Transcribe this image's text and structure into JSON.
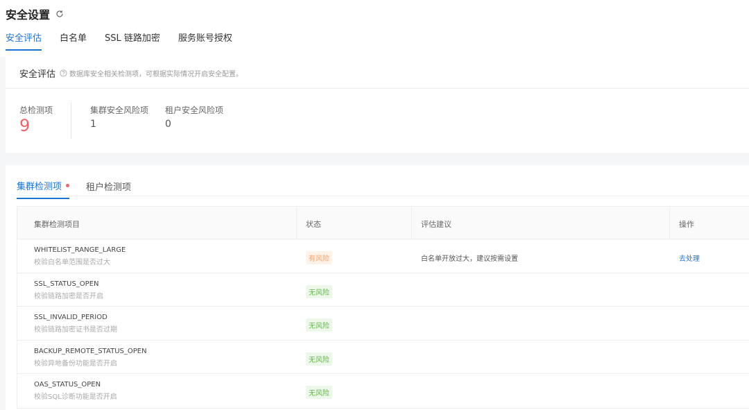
{
  "header": {
    "title": "安全设置",
    "tabs": [
      {
        "label": "安全评估",
        "active": true
      },
      {
        "label": "白名单",
        "active": false
      },
      {
        "label": "SSL 链路加密",
        "active": false
      },
      {
        "label": "服务账号授权",
        "active": false
      }
    ]
  },
  "assessment": {
    "title": "安全评估",
    "help": "数据库安全相关检测项，可根据实际情况开启安全配置。",
    "stats": [
      {
        "label": "总检测项",
        "value": "9"
      },
      {
        "label": "集群安全风险项",
        "value": "1"
      },
      {
        "label": "租户安全风险项",
        "value": "0"
      }
    ]
  },
  "checks": {
    "tabs": [
      {
        "label": "集群检测项",
        "active": true,
        "has_dot": true
      },
      {
        "label": "租户检测项",
        "active": false,
        "has_dot": false
      }
    ],
    "columns": [
      "集群检测项目",
      "状态",
      "评估建议",
      "操作"
    ],
    "rows": [
      {
        "name": "WHITELIST_RANGE_LARGE",
        "desc": "校验白名单范围是否过大",
        "status": "有风险",
        "risk": true,
        "advice": "白名单开放过大，建议按需设置",
        "action": "去处理"
      },
      {
        "name": "SSL_STATUS_OPEN",
        "desc": "校验链路加密是否开启",
        "status": "无风险",
        "risk": false,
        "advice": "",
        "action": ""
      },
      {
        "name": "SSL_INVALID_PERIOD",
        "desc": "校验链路加密证书是否过期",
        "status": "无风险",
        "risk": false,
        "advice": "",
        "action": ""
      },
      {
        "name": "BACKUP_REMOTE_STATUS_OPEN",
        "desc": "校验异地备份功能是否开启",
        "status": "无风险",
        "risk": false,
        "advice": "",
        "action": ""
      },
      {
        "name": "OAS_STATUS_OPEN",
        "desc": "校验SQL诊断功能是否开启",
        "status": "无风险",
        "risk": false,
        "advice": "",
        "action": ""
      }
    ]
  },
  "colors": {
    "accent": "#1a73d9",
    "danger": "#f0616a",
    "risk_bg": "#fff2e8",
    "risk_fg": "#f5a36a",
    "safe_bg": "#edf8ea",
    "safe_fg": "#63b74b"
  },
  "icons": {
    "refresh": "refresh-icon",
    "help": "help-circle-icon"
  }
}
